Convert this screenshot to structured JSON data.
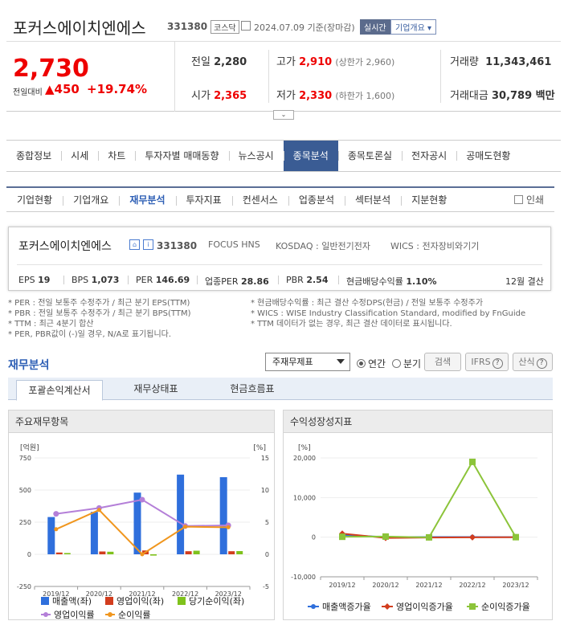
{
  "header": {
    "name": "포커스에이치엔에스",
    "code": "331380",
    "market": "코스닥",
    "date": "2024.07.09 기준(장마감)",
    "realtime": "실시간",
    "company_overview": "기업개요 ▾"
  },
  "price": {
    "current": "2,730",
    "compare_label": "전일대비",
    "change": "▲450",
    "change_pct": "+19.74%",
    "prev_label": "전일",
    "prev": "2,280",
    "open_label": "시가",
    "open": "2,365",
    "high_label": "고가",
    "high": "2,910",
    "upper_limit": "(상한가 2,960)",
    "low_label": "저가",
    "low": "2,330",
    "lower_limit": "(하한가 1,600)",
    "volume_label": "거래량",
    "volume": "11,343,461",
    "amount_label": "거래대금",
    "amount": "30,789 백만"
  },
  "main_tabs": [
    "종합정보",
    "시세",
    "차트",
    "투자자별 매매동향",
    "뉴스공시",
    "종목분석",
    "종목토론실",
    "전자공시",
    "공매도현황"
  ],
  "sub_tabs": [
    "기업현황",
    "기업개요",
    "재무분석",
    "투자지표",
    "컨센서스",
    "업종분석",
    "섹터분석",
    "지분현황"
  ],
  "print_label": "인쇄",
  "company": {
    "name": "포커스에이치엔에스",
    "code": "331380",
    "eng": "FOCUS HNS",
    "kosdaq": "KOSDAQ : 일반전기전자",
    "wics": "WICS : 전자장비와기기",
    "eps_label": "EPS",
    "eps": "19",
    "bps_label": "BPS",
    "bps": "1,073",
    "per_label": "PER",
    "per": "146.69",
    "iper_label": "업종PER",
    "iper": "28.86",
    "pbr_label": "PBR",
    "pbr": "2.54",
    "div_label": "현금배당수익률",
    "div": "1.10%",
    "settle": "12월 결산"
  },
  "notes": {
    "left": [
      "* PER : 전일 보통주 수정주가 / 최근 분기 EPS(TTM)",
      "* PBR : 전일 보통주 수정주가 / 최근 분기 BPS(TTM)",
      "* TTM : 최근 4분기 합산",
      "* PER, PBR값이 (-)일 경우, N/A로 표기됩니다."
    ],
    "right": [
      "* 현금배당수익률 : 최근 결산 수정DPS(현금) / 전일 보통주 수정주가",
      "* WICS : WISE Industry Classification Standard, modified by FnGuide",
      "* TTM 데이터가 없는 경우, 최근 결산 데이터로 표시됩니다."
    ]
  },
  "fin": {
    "title": "재무분석",
    "select": "주재무제표",
    "annual": "연간",
    "quarter": "분기",
    "search": "검색",
    "ifrs": "IFRS",
    "formula": "산식",
    "tabs": [
      "포괄손익계산서",
      "재무상태표",
      "현금흐름표"
    ]
  },
  "charts": {
    "left_title": "주요재무항목",
    "right_title": "수익성장성지표",
    "left_unit": "[억원]",
    "pct_unit": "[%]",
    "colors": {
      "revenue": "#2f6fdc",
      "op": "#d23d1e",
      "net": "#7fc21c",
      "opm": "#b47fd8",
      "npm": "#f0961e"
    }
  },
  "chart_data": [
    {
      "type": "bar",
      "title": "주요재무항목",
      "categories": [
        "2019/12",
        "2020/12",
        "2021/12",
        "2022/12",
        "2023/12"
      ],
      "ylim": [
        -250,
        750
      ],
      "yticks": [
        "750",
        "500",
        "250",
        "0",
        "-250"
      ],
      "y2lim": [
        -5,
        15
      ],
      "y2ticks": [
        "15",
        "10",
        "5",
        "0",
        "-5"
      ],
      "series": [
        {
          "name": "매출액(좌)",
          "values": [
            290,
            330,
            480,
            620,
            600
          ]
        },
        {
          "name": "영업이익(좌)",
          "values": [
            14,
            22,
            30,
            24,
            24
          ]
        },
        {
          "name": "당기순이익(좌)",
          "values": [
            10,
            20,
            -10,
            28,
            25
          ]
        },
        {
          "name": "영업이익률",
          "values": [
            6.3,
            7.2,
            8.5,
            4.4,
            4.5
          ]
        },
        {
          "name": "순이익률",
          "values": [
            3.9,
            6.9,
            0.0,
            4.3,
            4.2
          ]
        }
      ]
    },
    {
      "type": "line",
      "title": "수익성장성지표",
      "categories": [
        "2019/12",
        "2020/12",
        "2021/12",
        "2022/12",
        "2023/12"
      ],
      "ylim": [
        -10000,
        20000
      ],
      "yticks": [
        "20,000",
        "10,000",
        "0",
        "-10,000"
      ],
      "series": [
        {
          "name": "매출액증가율",
          "values": [
            600,
            20,
            45,
            30,
            -3
          ]
        },
        {
          "name": "영업이익증가율",
          "values": [
            900,
            -200,
            -100,
            -50,
            0
          ]
        },
        {
          "name": "순이익증가율",
          "values": [
            100,
            150,
            -50,
            19000,
            0
          ]
        }
      ]
    }
  ]
}
